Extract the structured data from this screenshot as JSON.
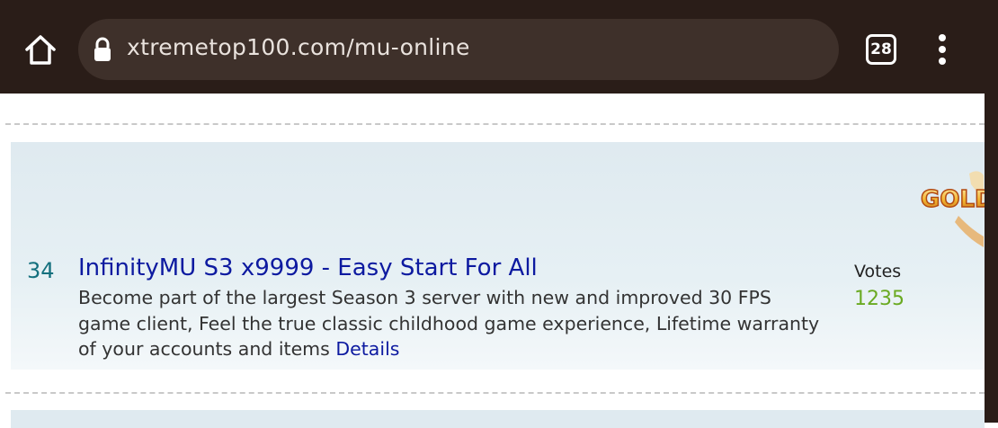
{
  "browser": {
    "url": "xtremetop100.com/mu-online",
    "tab_count": "28"
  },
  "listing": {
    "rank": "34",
    "title": "InfinityMU S3 x9999 - Easy Start For All",
    "description": "Become part of the largest Season 3 server with new and improved 30 FPS game client, Feel the true classic childhood game experience, Lifetime warranty of your accounts and items",
    "details_label": "Details",
    "votes_label": "Votes",
    "votes_count": "1235",
    "badge_text": "GOLD"
  },
  "colors": {
    "toolbar_bg": "#2a1d18",
    "url_bar_bg": "#3e302a",
    "listing_bg": "#dfeaf0",
    "link": "#0d1aa0",
    "rank": "#14707e",
    "votes": "#6aaa22"
  }
}
